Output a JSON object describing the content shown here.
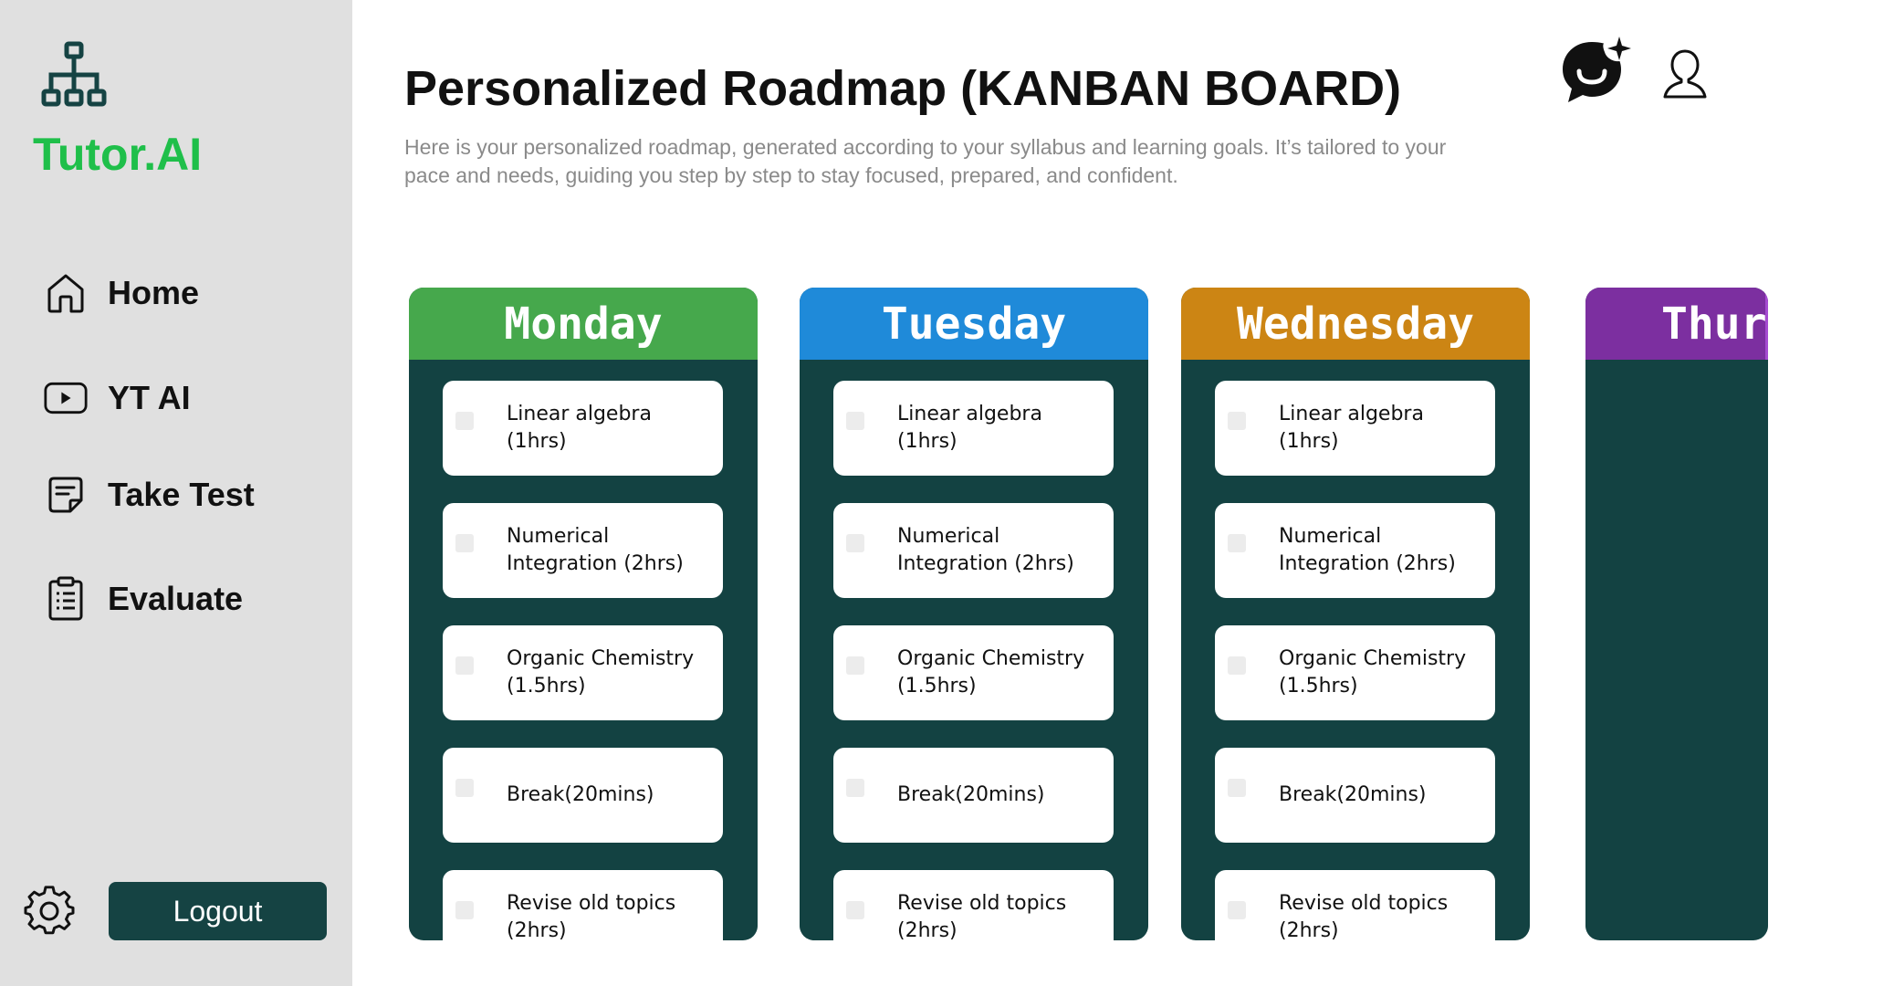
{
  "brand": {
    "name": "Tutor.AI",
    "color": "#1fbf4a",
    "icon": "sitemap-icon"
  },
  "nav": [
    {
      "label": "Home",
      "icon": "home-icon"
    },
    {
      "label": "YT AI",
      "icon": "youtube-play-icon"
    },
    {
      "label": "Take Test",
      "icon": "test-note-icon"
    },
    {
      "label": "Evaluate",
      "icon": "clipboard-list-icon"
    }
  ],
  "footer": {
    "logout_label": "Logout",
    "settings_icon": "gear-icon"
  },
  "header": {
    "title": "Personalized Roadmap (KANBAN BOARD)",
    "description": "Here is your personalized roadmap, generated according to your syllabus and learning goals. It’s tailored to your pace and needs, guiding you step by step to stay focused, prepared, and confident.",
    "chat_icon": "ai-chat-icon",
    "profile_icon": "user-icon"
  },
  "board": {
    "columns": [
      {
        "day": "Monday",
        "color": "#46a84c",
        "tasks": [
          "Linear algebra (1hrs)",
          "Numerical Integration (2hrs)",
          "Organic Chemistry (1.5hrs)",
          "Break(20mins)",
          "Revise old topics (2hrs)"
        ]
      },
      {
        "day": "Tuesday",
        "color": "#1f8ad9",
        "tasks": [
          "Linear algebra (1hrs)",
          "Numerical Integration (2hrs)",
          "Organic Chemistry (1.5hrs)",
          "Break(20mins)",
          "Revise old topics (2hrs)"
        ]
      },
      {
        "day": "Wednesday",
        "color": "#cc8514",
        "tasks": [
          "Linear algebra (1hrs)",
          "Numerical Integration (2hrs)",
          "Organic Chemistry (1.5hrs)",
          "Break(20mins)",
          "Revise old topics (2hrs)"
        ]
      },
      {
        "day": "Thur",
        "color": "#7c2fa0",
        "tasks": []
      }
    ]
  }
}
